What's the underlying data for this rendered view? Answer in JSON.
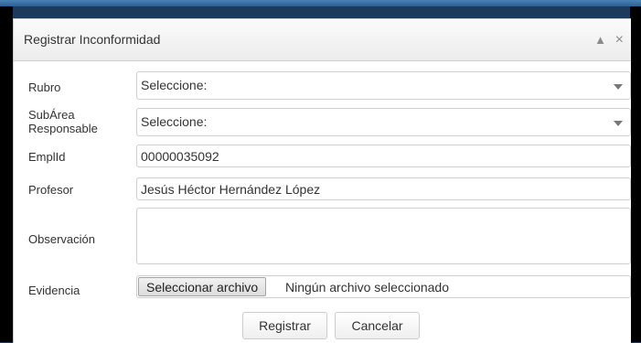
{
  "dialog": {
    "title": "Registrar Inconformidad",
    "collapse_glyph": "▲",
    "close_glyph": "×"
  },
  "form": {
    "rubro": {
      "label": "Rubro",
      "value": "Seleccione:"
    },
    "subarea": {
      "label_line1": "SubÁrea",
      "label_line2": "Responsable",
      "value": "Seleccione:"
    },
    "emplid": {
      "label": "EmplId",
      "value": "00000035092"
    },
    "profesor": {
      "label": "Profesor",
      "value": "Jesús Héctor Hernández López"
    },
    "observacion": {
      "label": "Observación",
      "value": ""
    },
    "evidencia": {
      "label": "Evidencia",
      "button": "Seleccionar archivo",
      "status": "Ningún archivo seleccionado"
    }
  },
  "actions": {
    "register": "Registrar",
    "cancel": "Cancelar"
  }
}
